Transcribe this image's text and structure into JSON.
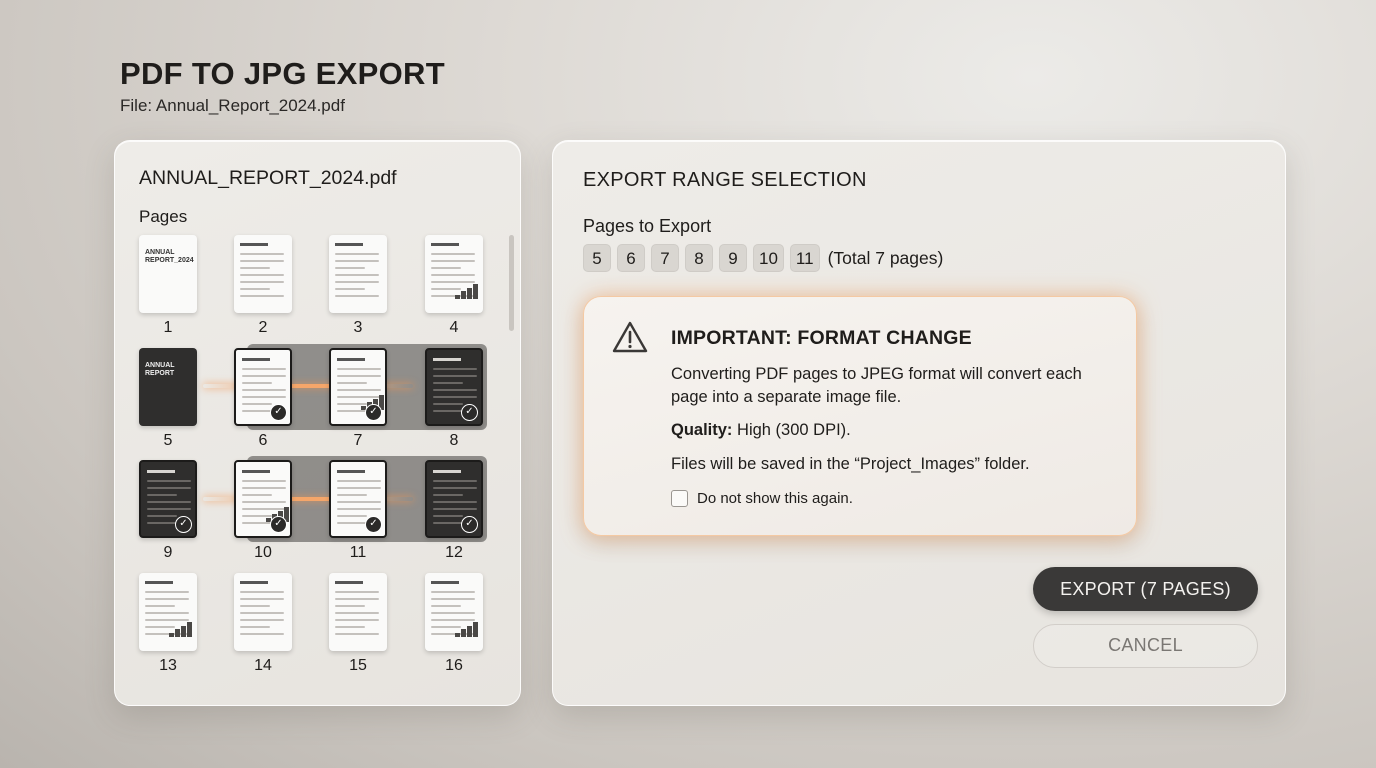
{
  "header": {
    "title": "PDF TO JPG EXPORT",
    "subtitle": "File: Annual_Report_2024.pdf"
  },
  "left_panel": {
    "file_name": "ANNUAL_REPORT_2024.pdf",
    "pages_label": "Pages",
    "pages": [
      {
        "num": "1",
        "cover": "ANNUAL REPORT_2024",
        "selected": false,
        "dark": false
      },
      {
        "num": "2",
        "selected": false,
        "dark": false
      },
      {
        "num": "3",
        "selected": false,
        "dark": false
      },
      {
        "num": "4",
        "selected": false,
        "dark": false
      },
      {
        "num": "5",
        "cover": "ANNUAL REPORT",
        "selected": false,
        "dark": true
      },
      {
        "num": "6",
        "selected": true,
        "dark": false
      },
      {
        "num": "7",
        "selected": true,
        "dark": false
      },
      {
        "num": "8",
        "selected": true,
        "dark": true
      },
      {
        "num": "9",
        "selected": true,
        "dark": true
      },
      {
        "num": "10",
        "selected": true,
        "dark": false
      },
      {
        "num": "11",
        "selected": true,
        "dark": false
      },
      {
        "num": "12",
        "selected": true,
        "dark": true
      },
      {
        "num": "13",
        "selected": false,
        "dark": false
      },
      {
        "num": "14",
        "selected": false,
        "dark": false
      },
      {
        "num": "15",
        "selected": false,
        "dark": false
      },
      {
        "num": "16",
        "selected": false,
        "dark": false
      }
    ]
  },
  "right_panel": {
    "title": "EXPORT RANGE SELECTION",
    "pages_to_export_label": "Pages to Export",
    "chips": [
      "5",
      "6",
      "7",
      "8",
      "9",
      "10",
      "11"
    ],
    "total_text": "(Total 7 pages)",
    "warning": {
      "title": "IMPORTANT: FORMAT CHANGE",
      "body": "Converting PDF pages to JPEG format will convert each page into a separate image file.",
      "quality_label": "Quality:",
      "quality_value": "High (300 DPI).",
      "folder_note": "Files will be saved in the “Project_Images” folder.",
      "dont_show": "Do not show this again.",
      "dont_show_checked": false,
      "accent_color": "#f5a66a"
    },
    "export_button": "EXPORT (7 PAGES)",
    "cancel_button": "CANCEL"
  },
  "icons": {
    "warning": "warning-triangle-icon",
    "check": "checkmark-icon"
  }
}
